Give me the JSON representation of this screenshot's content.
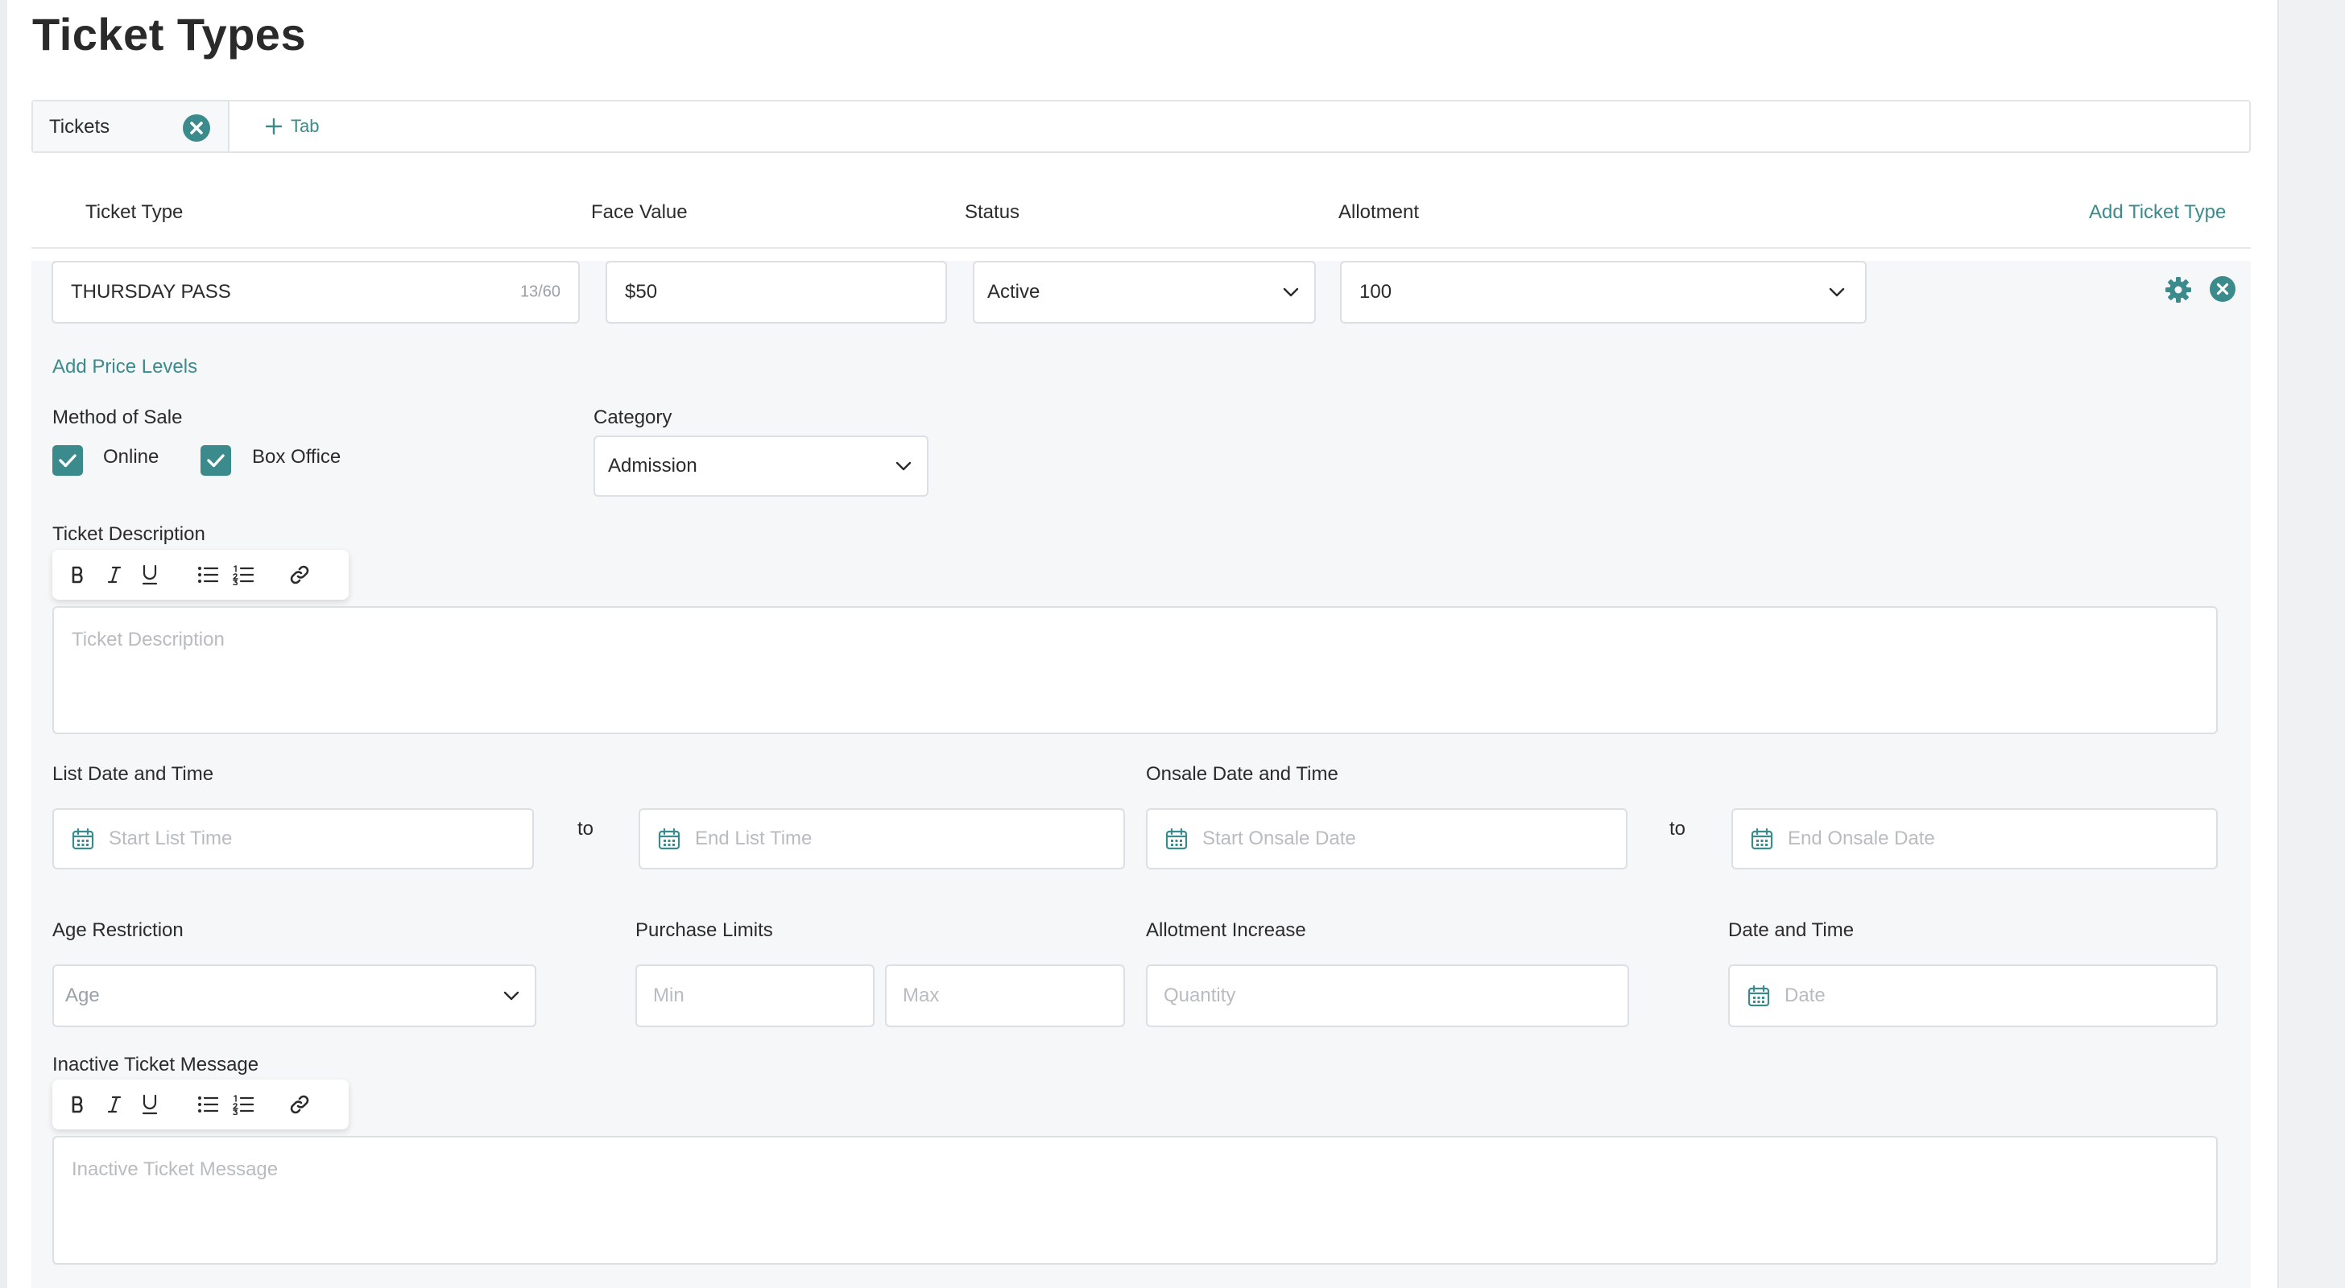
{
  "page": {
    "title": "Ticket Types"
  },
  "tabs": {
    "items": [
      {
        "label": "Tickets"
      }
    ],
    "add_label": "Tab"
  },
  "columns": {
    "ticket_type": "Ticket Type",
    "face_value": "Face Value",
    "status": "Status",
    "allotment": "Allotment"
  },
  "add_ticket_type_label": "Add Ticket Type",
  "ticket": {
    "name": "THURSDAY PASS",
    "name_counter": "13/60",
    "face_value": "$50",
    "status": "Active",
    "allotment": "100",
    "add_price_levels_label": "Add Price Levels",
    "method_of_sale": {
      "label": "Method of Sale",
      "options": [
        {
          "label": "Online",
          "checked": true
        },
        {
          "label": "Box Office",
          "checked": true
        }
      ]
    },
    "category": {
      "label": "Category",
      "value": "Admission"
    },
    "description": {
      "label": "Ticket Description",
      "placeholder": "Ticket Description"
    },
    "list_date": {
      "label": "List Date and Time",
      "start_placeholder": "Start List Time",
      "to": "to",
      "end_placeholder": "End List Time"
    },
    "onsale_date": {
      "label": "Onsale Date and Time",
      "start_placeholder": "Start Onsale Date",
      "to": "to",
      "end_placeholder": "End Onsale Date"
    },
    "age_restriction": {
      "label": "Age Restriction",
      "placeholder": "Age"
    },
    "purchase_limits": {
      "label": "Purchase Limits",
      "min_placeholder": "Min",
      "max_placeholder": "Max"
    },
    "allotment_increase": {
      "label": "Allotment Increase",
      "placeholder": "Quantity"
    },
    "date_time": {
      "label": "Date and Time",
      "placeholder": "Date"
    },
    "inactive_message": {
      "label": "Inactive Ticket Message",
      "placeholder": "Inactive Ticket Message"
    }
  },
  "toolbar_buttons": [
    "bold-icon",
    "italic-icon",
    "underline-icon",
    "bullet-list-icon",
    "numbered-list-icon",
    "link-icon"
  ],
  "colors": {
    "accent": "#3b8a8c",
    "panel_bg": "#f6f7f8",
    "border": "#dcdfe3",
    "placeholder": "#b8bcc1"
  }
}
